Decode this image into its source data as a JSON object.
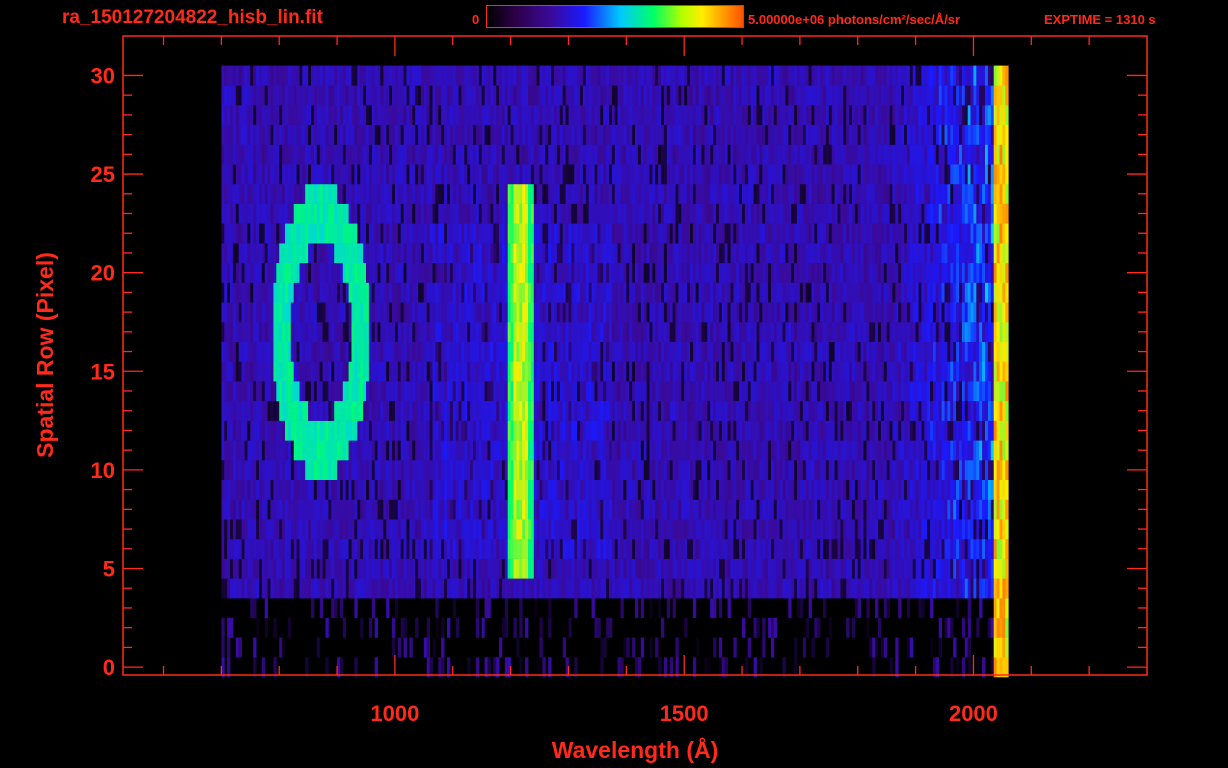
{
  "header": {
    "title": "ra_150127204822_hisb_lin.fit",
    "colorbar_min": "0",
    "colorbar_max": "5.00000e+06 photons/cm²/sec/Å/sr",
    "exptime": "EXPTIME = 1310 s"
  },
  "chart_data": {
    "type": "heatmap",
    "title": "ra_150127204822_hisb_lin.fit",
    "xlabel": "Wavelength (Å)",
    "ylabel": "Spatial Row (Pixel)",
    "xlim": [
      530,
      2300
    ],
    "ylim": [
      -0.4,
      32
    ],
    "x_ticks": [
      1000,
      1500,
      2000
    ],
    "y_ticks": [
      0,
      5,
      10,
      15,
      20,
      25,
      30
    ],
    "colorbar": {
      "min": 0,
      "max": 5000000,
      "units": "photons/cm²/sec/Å/sr"
    },
    "colors": {
      "axis": "#ff2a1a",
      "background": "#000000",
      "colormap": [
        "#000000",
        "#3a0a9a",
        "#1a1aff",
        "#00c8ff",
        "#00ff66",
        "#ffee00",
        "#ff5000"
      ]
    },
    "features": [
      {
        "name": "detector data",
        "x_range": [
          700,
          2055
        ],
        "rows": [
          4,
          30
        ],
        "level": 0.28
      },
      {
        "name": "bright emission line",
        "x_center": 1215,
        "rows": [
          5,
          24
        ],
        "level": 0.72
      },
      {
        "name": "ring feature",
        "x_range": [
          790,
          950
        ],
        "rows": [
          10,
          24
        ],
        "level": 0.55
      },
      {
        "name": "red-end edge",
        "x_center": 2045,
        "rows": [
          0,
          30
        ],
        "level": 0.75
      }
    ]
  }
}
